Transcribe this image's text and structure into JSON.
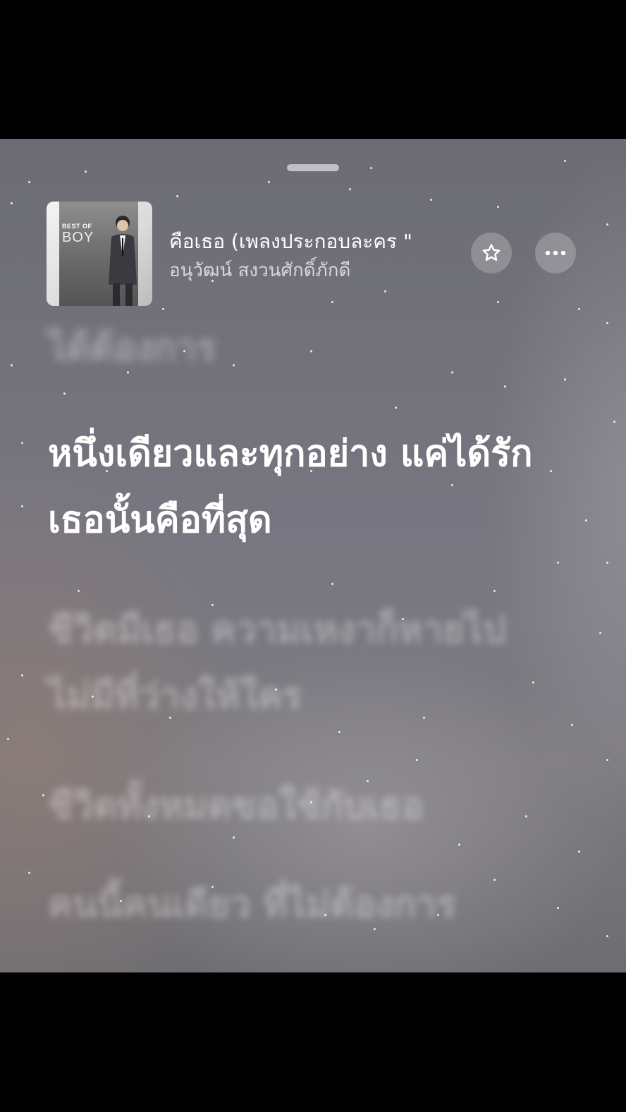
{
  "now_playing": {
    "title": "คือเธอ (เพลงประกอบละคร \"",
    "artist": "อนุวัฒน์ สงวนศักดิ์ภักดี",
    "album_art_text": "BEST OF",
    "album_art_name": "BOY"
  },
  "lyrics": {
    "previous": "ได้ต้องการ",
    "current": "หนึ่งเดียวและทุกอย่าง แค่ได้รักเธอนั้นคือที่สุด",
    "upcoming": [
      "ชีวิตมีเธอ ความเหงาก็หายไป ไม่มีที่ว่างให้ใคร",
      "ชีวิตทั้งหมดขอใช้กับเธอ",
      "คนนี้คนเดียว ที่ไม่ต้องการ"
    ]
  },
  "controls": {
    "favorite_icon": "star-icon",
    "more_icon": "ellipsis-icon"
  }
}
